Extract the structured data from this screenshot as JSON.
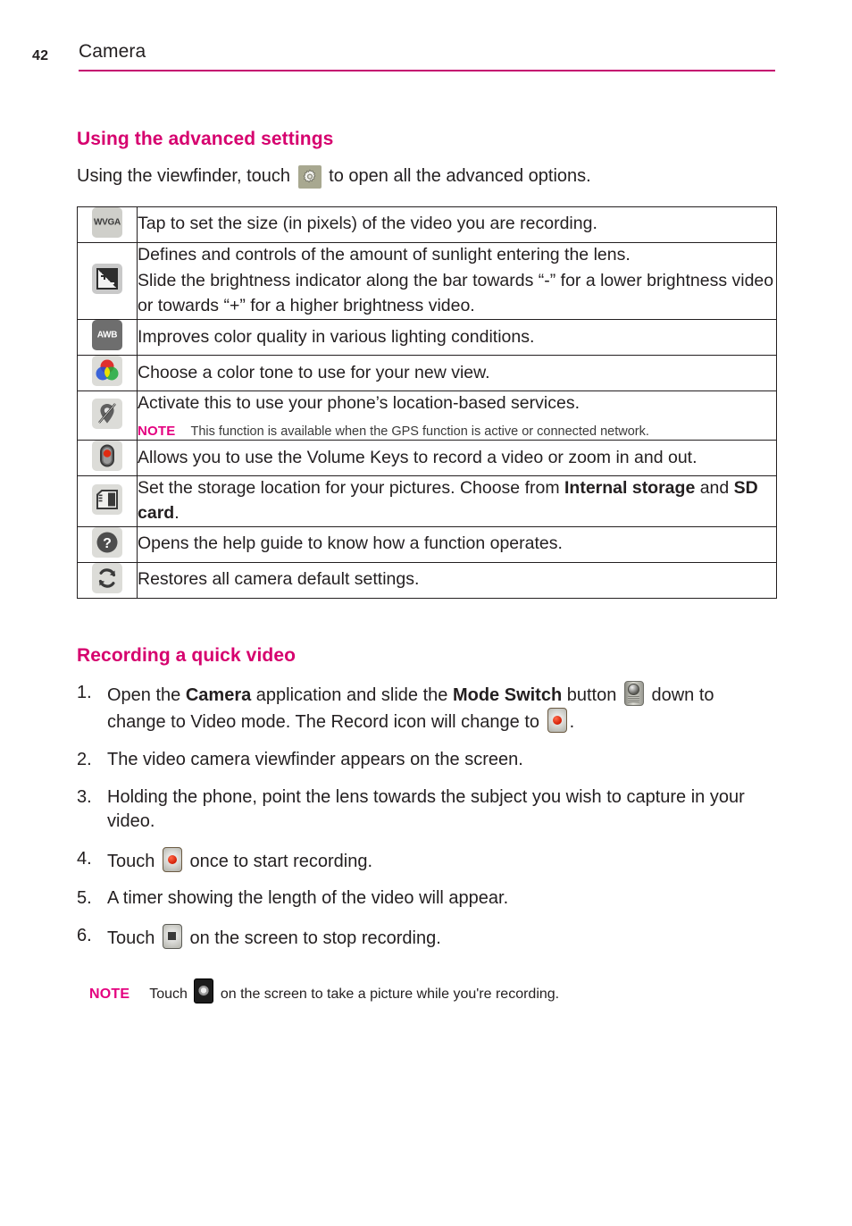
{
  "header": {
    "page_number": "42",
    "title": "Camera",
    "rule_color": "#c4036f"
  },
  "section1": {
    "heading": "Using the advanced settings",
    "intro_before": "Using the viewfinder, touch",
    "intro_after": "to open all the advanced options.",
    "gear_icon": "gear-icon"
  },
  "settings_table": {
    "rows": [
      {
        "icon": "wvga-icon",
        "icon_label": "WVGA",
        "lines": [
          "Tap to set the size (in pixels) of the video you are recording."
        ]
      },
      {
        "icon": "exposure-icon",
        "icon_label": "",
        "lines": [
          "Defines and controls of the amount of sunlight entering the lens.",
          "Slide the brightness indicator along the bar towards “-” for a lower brightness video or towards “+” for a higher brightness video."
        ]
      },
      {
        "icon": "white-balance-icon",
        "icon_label": "AWB",
        "lines": [
          "Improves color quality in various lighting conditions."
        ]
      },
      {
        "icon": "color-effect-icon",
        "icon_label": "",
        "lines": [
          "Choose a color tone to use for your new view."
        ]
      },
      {
        "icon": "geotag-location-icon",
        "icon_label": "",
        "lines": [
          "Activate this to use your phone’s location-based services."
        ],
        "note_label": "NOTE",
        "note_text": "This function is available when the GPS function is active or connected network."
      },
      {
        "icon": "volume-key-icon",
        "icon_label": "",
        "lines": [
          "Allows you to use the Volume Keys to record a video or zoom in and out."
        ]
      },
      {
        "icon": "storage-sd-card-icon",
        "icon_label": "",
        "lines_rich": {
          "part1": "Set the storage location for your pictures. Choose from ",
          "bold1": "Internal storage",
          "part2": " and ",
          "bold2": "SD card",
          "part3": "."
        }
      },
      {
        "icon": "help-icon",
        "icon_label": "?",
        "lines": [
          "Opens the help guide to know how a function operates."
        ]
      },
      {
        "icon": "reset-icon",
        "icon_label": "",
        "lines": [
          "Restores all camera default settings."
        ]
      }
    ]
  },
  "section2": {
    "heading": "Recording a quick video",
    "steps": [
      {
        "num": "1.",
        "p1": "Open the ",
        "b1": "Camera",
        "p2": " application and slide the ",
        "b2": "Mode Switch",
        "p3": " button ",
        "icon1": "mode-switch-icon",
        "p4": " down to change to Video mode. The Record icon will change to ",
        "icon2": "record-icon",
        "p5": "."
      },
      {
        "num": "2.",
        "text": "The video camera viewfinder appears on the screen."
      },
      {
        "num": "3.",
        "text": "Holding the phone, point the lens towards the subject you wish to capture in your video."
      },
      {
        "num": "4.",
        "p1": "Touch ",
        "icon1": "record-icon",
        "p2": " once to start recording."
      },
      {
        "num": "5.",
        "text": "A timer showing the length of the video will appear."
      },
      {
        "num": "6.",
        "p1": "Touch ",
        "icon1": "stop-recording-icon",
        "p2": " on the screen to stop recording."
      }
    ]
  },
  "bottom_note": {
    "label": "NOTE",
    "before": "Touch",
    "icon": "camera-shutter-icon",
    "after": "on the screen to take a picture while you're recording."
  },
  "colors": {
    "accent_magenta": "#d6006e",
    "note_pink": "#e4007f",
    "rule": "#c4036f",
    "text": "#231f20"
  }
}
